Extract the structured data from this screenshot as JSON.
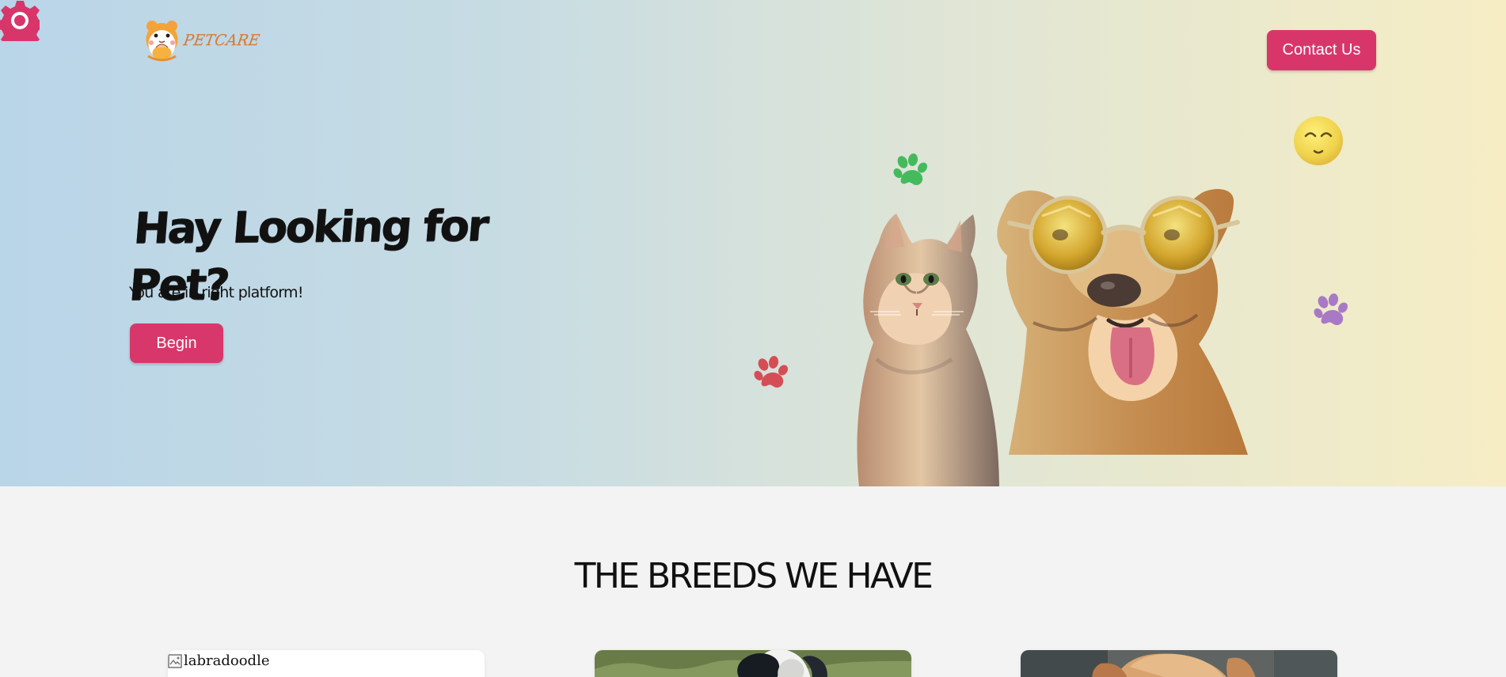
{
  "settings": {
    "icon": "gear-icon",
    "color": "#d8366b"
  },
  "header": {
    "logo_text": "PETCARE",
    "logo_icon": "hamster-icon",
    "contact_label": "Contact Us"
  },
  "hero": {
    "title": "Hay Looking for Pet?",
    "subtitle": "You are in right platform!",
    "cta_label": "Begin",
    "background_start": "#b9d5e8",
    "background_end": "#f6edc4",
    "accent": "#d8366b",
    "decorations": [
      {
        "name": "green-paw-icon",
        "color": "#45ba5d"
      },
      {
        "name": "red-paw-icon",
        "color": "#d64e55"
      },
      {
        "name": "purple-paw-icon",
        "color": "#a87ac5"
      },
      {
        "name": "smiling-face-icon",
        "color": "#f3d95c"
      }
    ]
  },
  "breeds": {
    "title": "THE BREEDS WE HAVE",
    "cards": [
      {
        "alt": "labradoodle"
      },
      {
        "alt": ""
      },
      {
        "alt": ""
      }
    ]
  }
}
